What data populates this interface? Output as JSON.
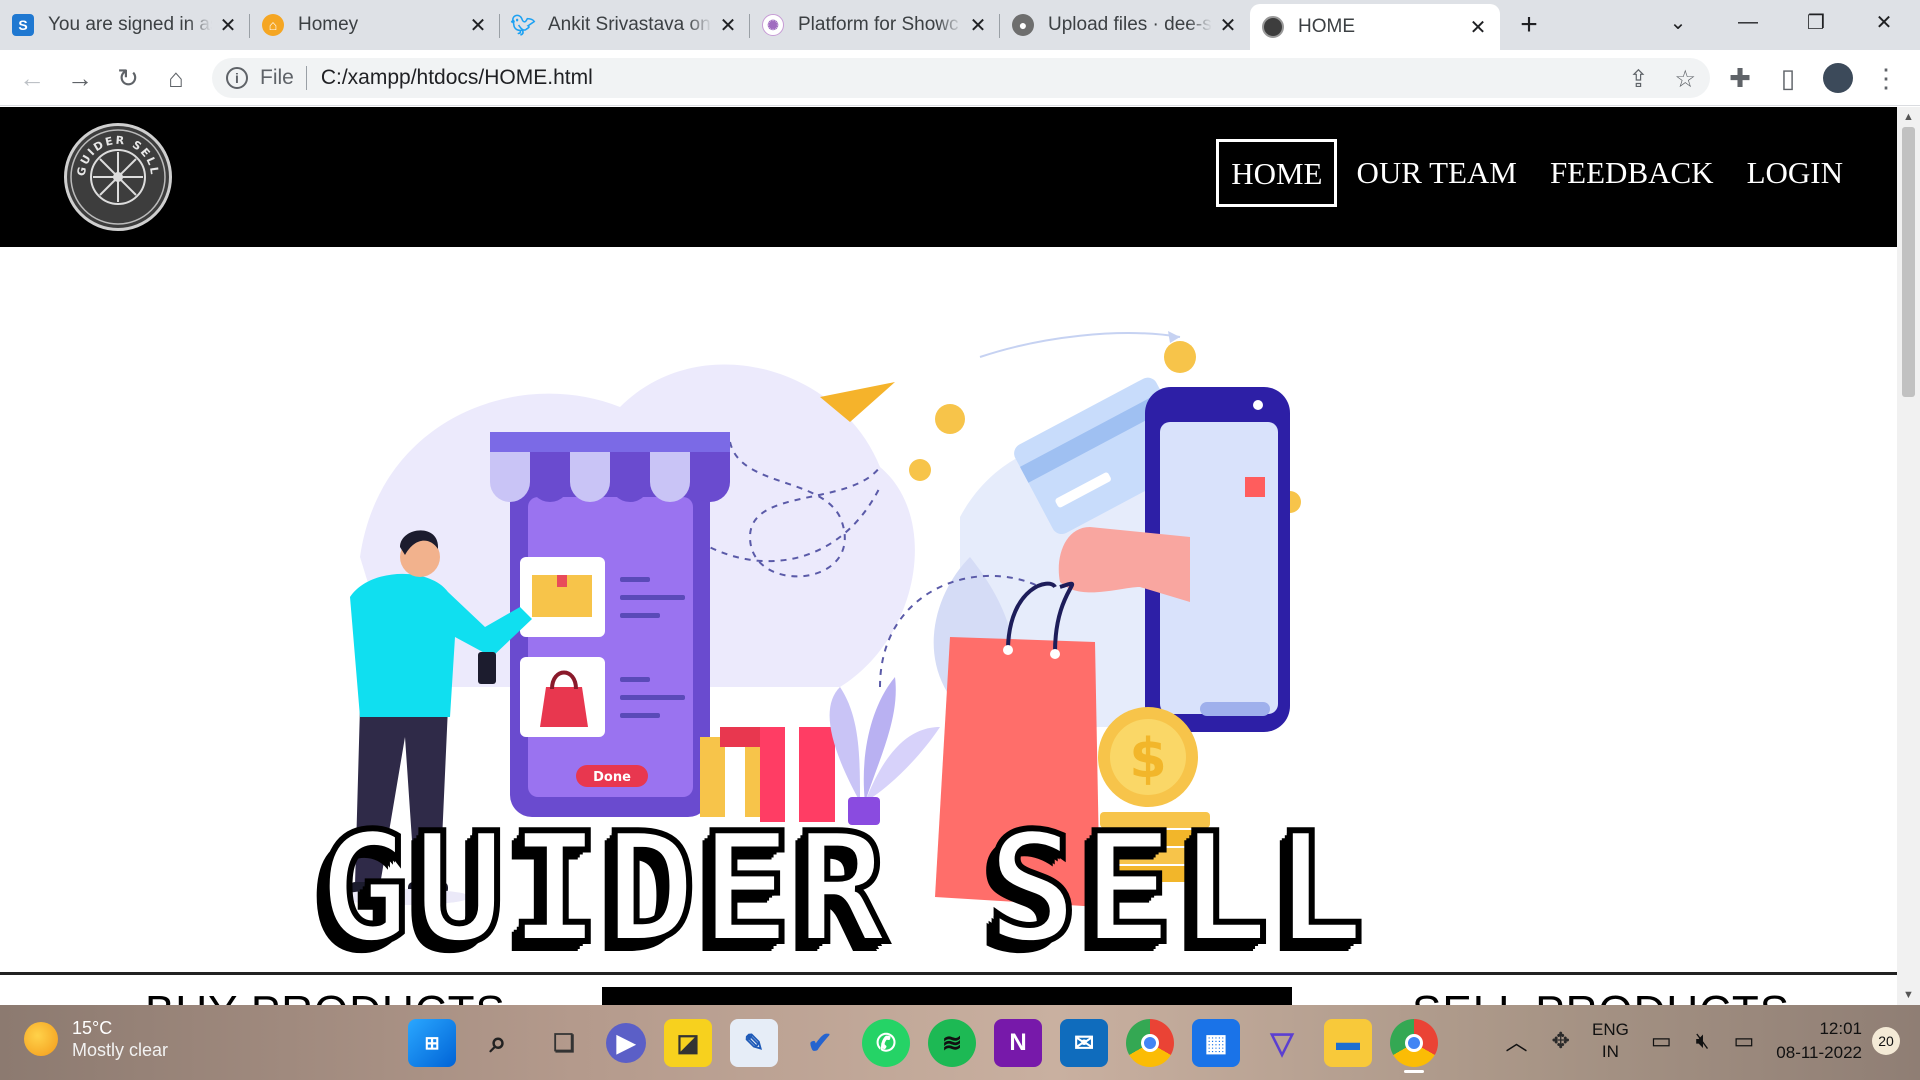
{
  "browser": {
    "tabs": [
      {
        "title": "You are signed in as",
        "favicon": "s-app-icon",
        "color": "#1f78d1"
      },
      {
        "title": "Homey",
        "favicon": "homey-icon",
        "color": "#f5a623"
      },
      {
        "title": "Ankit Srivastava on",
        "favicon": "twitter-icon",
        "color": "#1da1f2"
      },
      {
        "title": "Platform for Showc",
        "favicon": "platform-icon",
        "color": "#c79bd6"
      },
      {
        "title": "Upload files · dee-s",
        "favicon": "github-icon",
        "color": "#6e6e6e"
      },
      {
        "title": "HOME",
        "favicon": "site-icon",
        "color": "#3d3d3d"
      }
    ],
    "new_tab": "+",
    "address": {
      "scheme": "File",
      "url": "C:/xampp/htdocs/HOME.html"
    }
  },
  "site": {
    "logo_text": "GUIDER SELL",
    "nav": [
      "HOME",
      "OUR TEAM",
      "FEEDBACK",
      "LOGIN"
    ],
    "brand": "GUIDER SELL",
    "done_label": "Done",
    "sections": {
      "buy": "BUY PRODUCTS",
      "sell": "SELL PRODUCTS"
    }
  },
  "taskbar": {
    "weather": {
      "temp": "15°C",
      "desc": "Mostly clear"
    },
    "lang": [
      "ENG",
      "IN"
    ],
    "time": "12:01",
    "date": "08-11-2022",
    "notifications": "20"
  }
}
